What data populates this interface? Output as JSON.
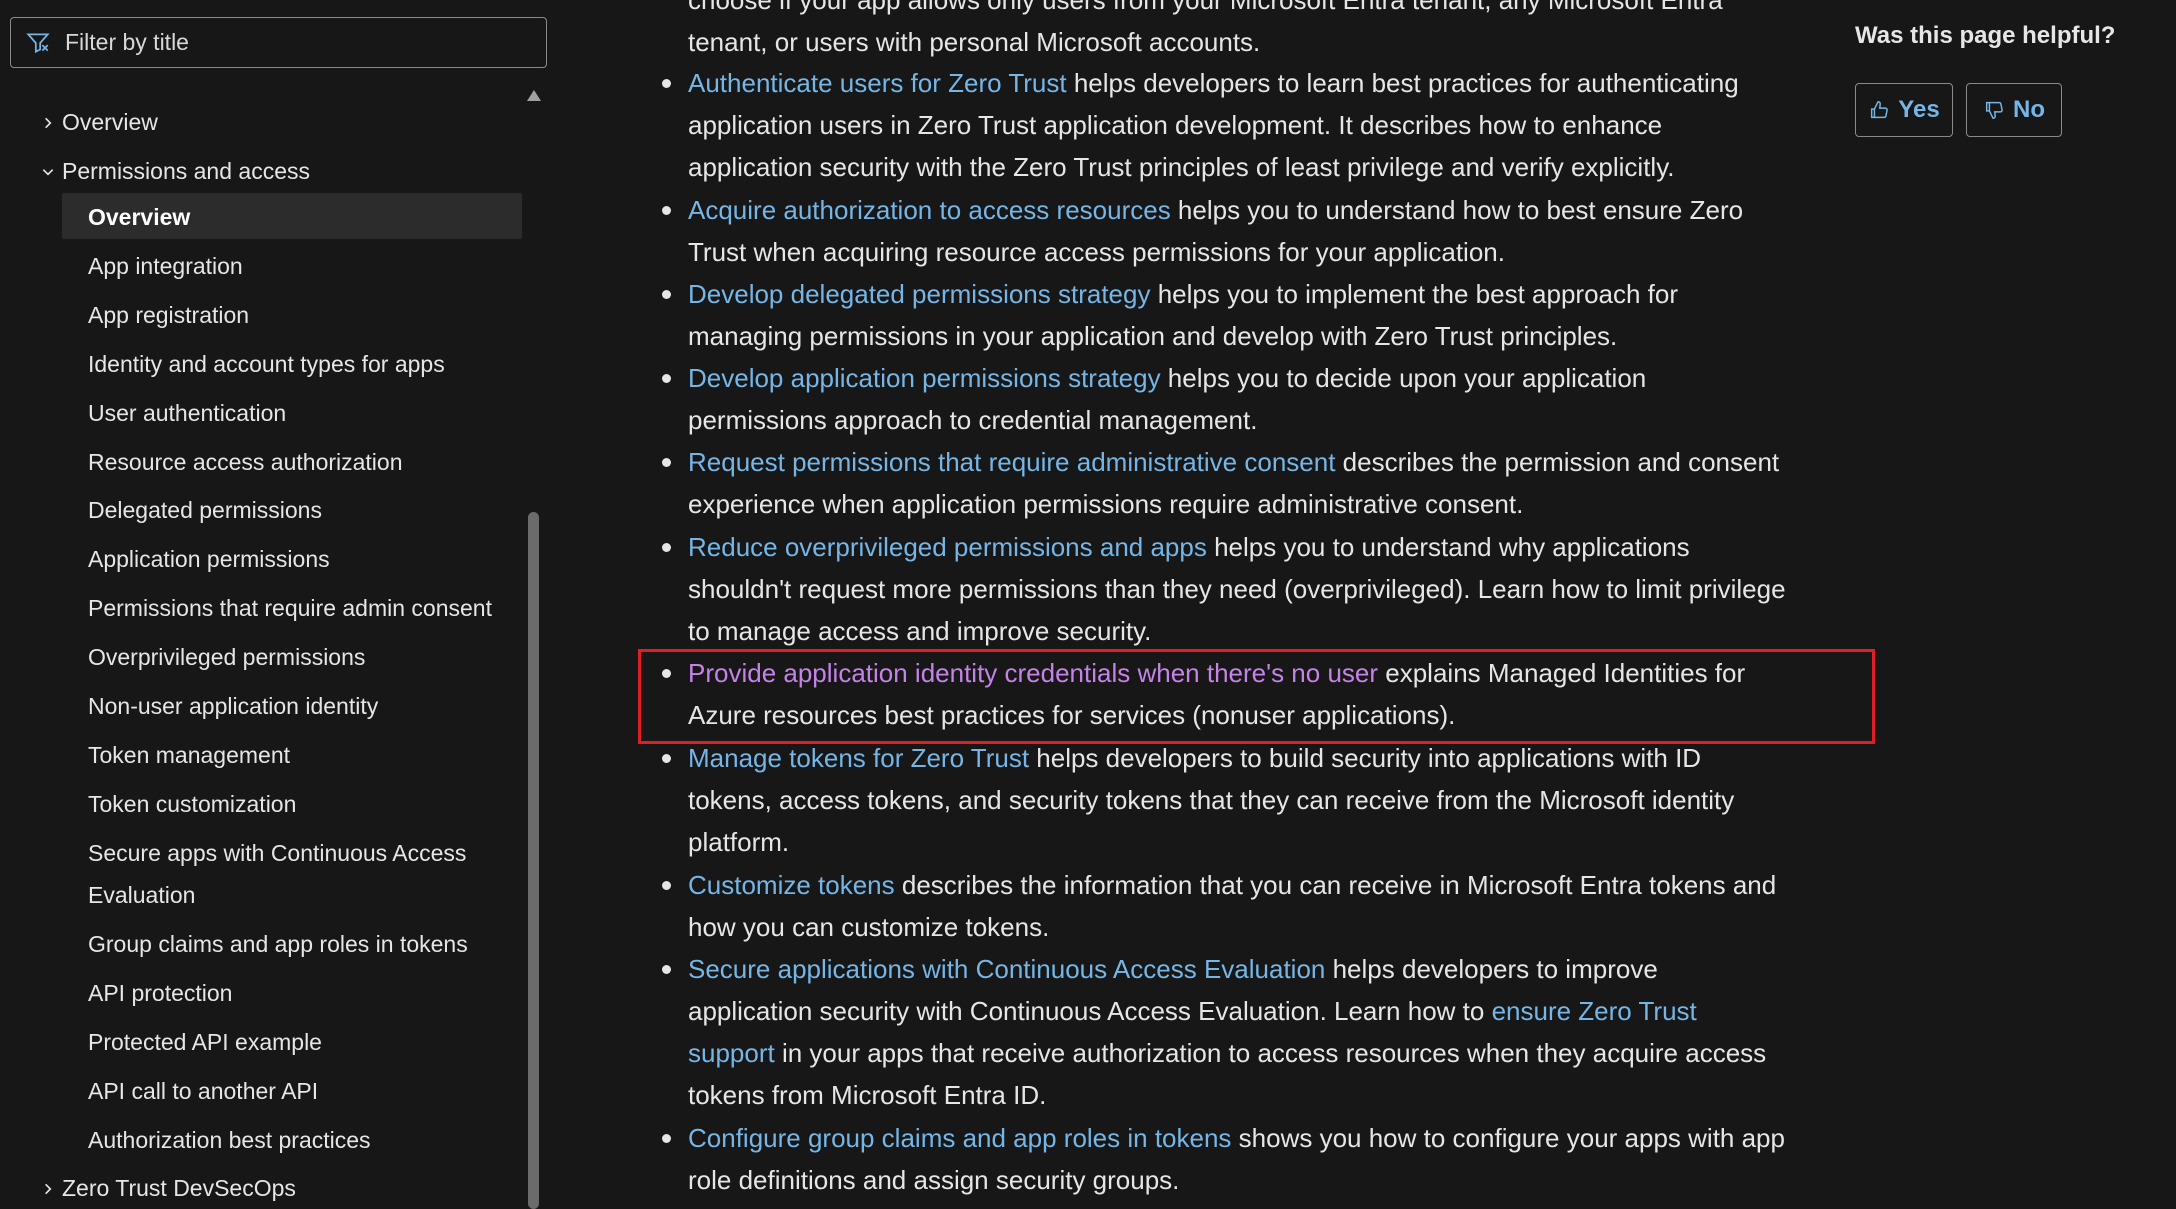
{
  "sidebar": {
    "filter_placeholder": "Filter by title",
    "items": [
      {
        "label": "Overview",
        "level": 1,
        "chevron": "chevron-right"
      },
      {
        "label": "Permissions and access",
        "level": 1,
        "chevron": "chevron-down"
      },
      {
        "label": "Overview",
        "level": 2,
        "active": true
      },
      {
        "label": "App integration",
        "level": 2
      },
      {
        "label": "App registration",
        "level": 2
      },
      {
        "label": "Identity and account types for apps",
        "level": 2
      },
      {
        "label": "User authentication",
        "level": 2
      },
      {
        "label": "Resource access authorization",
        "level": 2
      },
      {
        "label": "Delegated permissions",
        "level": 2
      },
      {
        "label": "Application permissions",
        "level": 2
      },
      {
        "label": "Permissions that require admin consent",
        "level": 2
      },
      {
        "label": "Overprivileged permissions",
        "level": 2
      },
      {
        "label": "Non-user application identity",
        "level": 2
      },
      {
        "label": "Token management",
        "level": 2
      },
      {
        "label": "Token customization",
        "level": 2
      },
      {
        "label": "Secure apps with Continuous Access",
        "level": 2
      },
      {
        "label": "Evaluation",
        "level": 2
      },
      {
        "label": "Group claims and app roles in tokens",
        "level": 2
      },
      {
        "label": "API protection",
        "level": 2
      },
      {
        "label": "Protected API example",
        "level": 2
      },
      {
        "label": "API call to another API",
        "level": 2
      },
      {
        "label": "Authorization best practices",
        "level": 2
      },
      {
        "label": "Zero Trust DevSecOps",
        "level": 1,
        "chevron": "chevron-right"
      }
    ]
  },
  "article": {
    "top_fragment_line1": "choose if your app allows only users from your Microsoft Entra tenant, any Microsoft Entra",
    "top_fragment_line2": "tenant, or users with personal Microsoft accounts.",
    "bullets": [
      {
        "link": "Authenticate users for Zero Trust",
        "text": " helps developers to learn best practices for authenticating application users in Zero Trust application development. It describes how to enhance application security with the Zero Trust principles of least privilege and verify explicitly."
      },
      {
        "link": "Acquire authorization to access resources",
        "text": " helps you to understand how to best ensure Zero Trust when acquiring resource access permissions for your application."
      },
      {
        "link": "Develop delegated permissions strategy",
        "text": " helps you to implement the best approach for managing permissions in your application and develop with Zero Trust principles."
      },
      {
        "link": "Develop application permissions strategy",
        "text": " helps you to decide upon your application permissions approach to credential management."
      },
      {
        "link": "Request permissions that require administrative consent",
        "text": " describes the permission and consent experience when application permissions require administrative consent."
      },
      {
        "link": "Reduce overprivileged permissions and apps",
        "text": " helps you to understand why applications shouldn't request more permissions than they need (overprivileged). Learn how to limit privilege to manage access and improve security."
      },
      {
        "link": "Provide application identity credentials when there's no user",
        "text": " explains Managed Identities for Azure resources best practices for services (nonuser applications).",
        "visited": true,
        "highlighted": true
      },
      {
        "link": "Manage tokens for Zero Trust",
        "text": " helps developers to build security into applications with ID tokens, access tokens, and security tokens that they can receive from the Microsoft identity platform."
      },
      {
        "link": "Customize tokens",
        "text": " describes the information that you can receive in Microsoft Entra tokens and how you can customize tokens."
      },
      {
        "link": "Secure applications with Continuous Access Evaluation",
        "text": " helps developers to improve application security with Continuous Access Evaluation. Learn how to ",
        "link2": "ensure Zero Trust support",
        "text2": " in your apps that receive authorization to access resources when they acquire access tokens from Microsoft Entra ID."
      },
      {
        "link": "Configure group claims and app roles in tokens",
        "text": " shows you how to configure your apps with app role definitions and assign security groups."
      }
    ]
  },
  "feedback": {
    "title": "Was this page helpful?",
    "yes_label": "Yes",
    "no_label": "No"
  },
  "colors": {
    "background": "#171717",
    "link": "#75b6e7",
    "visited_link": "#c583e8",
    "highlight_border": "#e01e25"
  }
}
